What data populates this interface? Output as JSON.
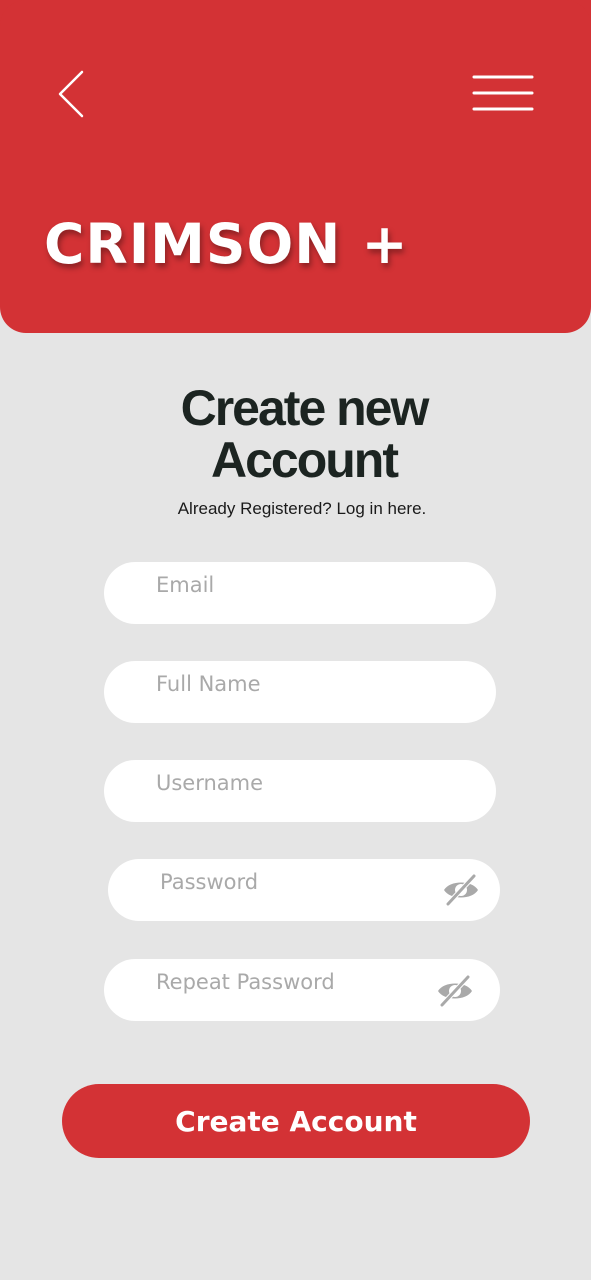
{
  "header": {
    "brand": "CRIMSON +",
    "back_icon": "chevron-left-icon",
    "menu_icon": "hamburger-menu-icon",
    "color": "#d33235"
  },
  "main": {
    "title_line1": "Create new",
    "title_line2": "Account",
    "login_prompt": "Already Registered? Log in here."
  },
  "form": {
    "email_placeholder": "Email",
    "fullname_placeholder": "Full Name",
    "username_placeholder": "Username",
    "password_placeholder": "Password",
    "repeat_password_placeholder": "Repeat Password",
    "visibility_icon": "eye-slash-icon",
    "submit_label": "Create Account"
  }
}
